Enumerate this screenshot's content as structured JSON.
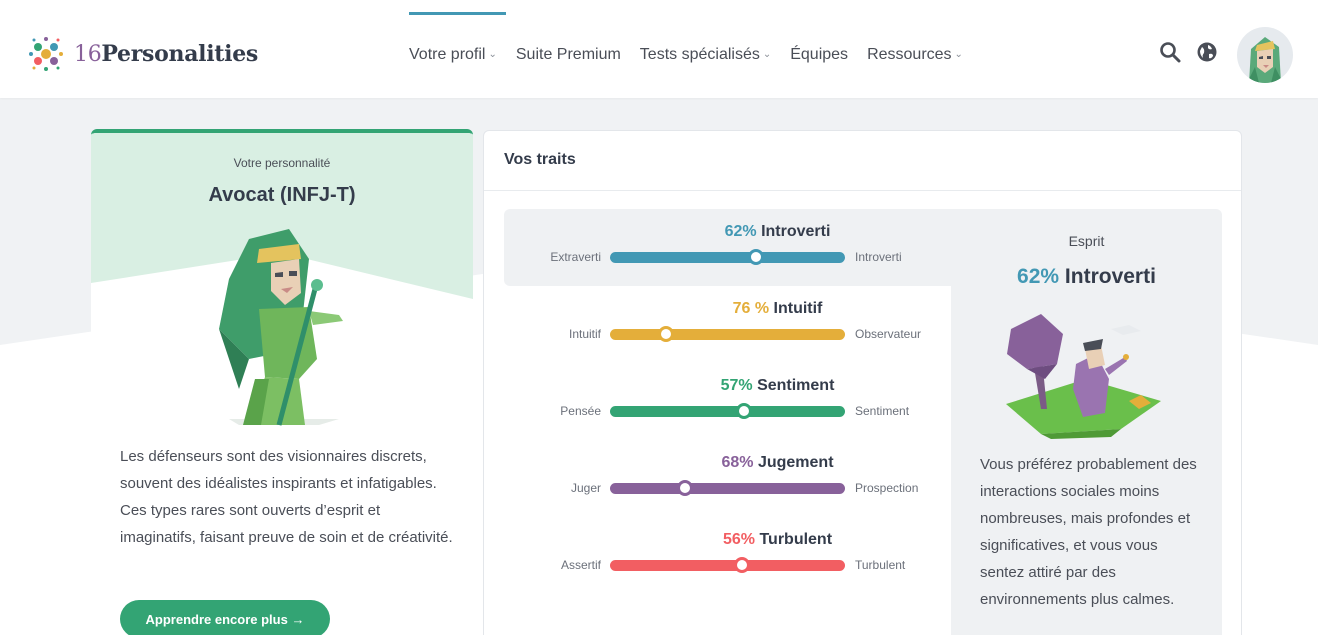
{
  "header": {
    "logo_number": "16",
    "logo_word": "Personalities",
    "nav": [
      {
        "label": "Votre profil",
        "dropdown": true,
        "active": true
      },
      {
        "label": "Suite Premium",
        "dropdown": false
      },
      {
        "label": "Tests spécialisés",
        "dropdown": true
      },
      {
        "label": "Équipes",
        "dropdown": false
      },
      {
        "label": "Ressources",
        "dropdown": true
      }
    ],
    "icons": [
      "search-icon",
      "globe-icon"
    ]
  },
  "personality": {
    "kicker": "Votre personnalité",
    "title": "Avocat (INFJ-T)",
    "description": "Les défenseurs sont des visionnaires discrets, souvent des idéalistes inspirants et infatigables. Ces types rares sont ouverts d’esprit et imaginatifs, faisant preuve de soin et de créativité.",
    "button": "Apprendre encore plus →"
  },
  "traits": {
    "title": "Vos traits",
    "items": [
      {
        "pct": "62%",
        "name": "Introverti",
        "left": "Extraverti",
        "right": "Introverti",
        "value": 62,
        "side": "right",
        "color": "#4298b4"
      },
      {
        "pct": "76 %",
        "name": "Intuitif",
        "left": "Intuitif",
        "right": "Observateur",
        "value": 76,
        "side": "left",
        "color": "#e4ae3a"
      },
      {
        "pct": "57%",
        "name": "Sentiment",
        "left": "Pensée",
        "right": "Sentiment",
        "value": 57,
        "side": "right",
        "color": "#33a474"
      },
      {
        "pct": "68%",
        "name": "Jugement",
        "left": "Juger",
        "right": "Prospection",
        "value": 68,
        "side": "left",
        "color": "#88619a"
      },
      {
        "pct": "56%",
        "name": "Turbulent",
        "left": "Assertif",
        "right": "Turbulent",
        "value": 56,
        "side": "right",
        "color": "#f25e62"
      }
    ]
  },
  "detail": {
    "kicker": "Esprit",
    "pct": "62%",
    "name": "Introverti",
    "text": "Vous préférez probablement des interactions sociales moins nombreuses, mais profondes et significatives, et vous vous sentez attiré par des environnements plus calmes."
  }
}
